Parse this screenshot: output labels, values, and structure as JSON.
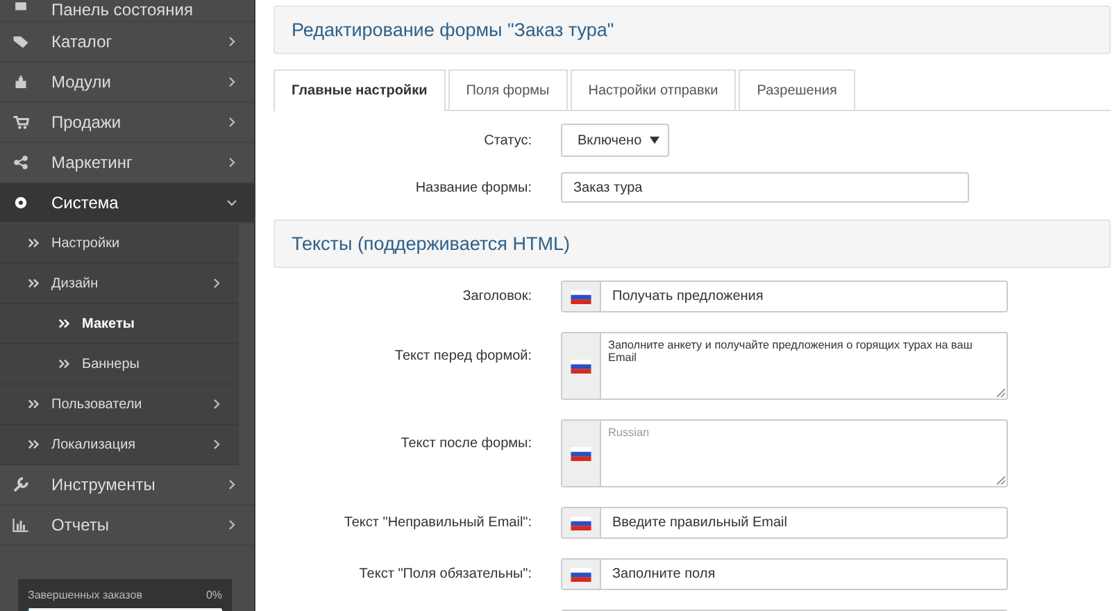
{
  "sidebar": {
    "items": [
      {
        "label": "Панель состояния",
        "selected": false
      },
      {
        "label": "Каталог",
        "selected": false,
        "expanded": false
      },
      {
        "label": "Модули",
        "selected": false,
        "expanded": false
      },
      {
        "label": "Продажи",
        "selected": false,
        "expanded": false
      },
      {
        "label": "Маркетинг",
        "selected": false,
        "expanded": false
      },
      {
        "label": "Система",
        "selected": false,
        "expanded": true,
        "children": [
          {
            "label": "Настройки",
            "selected": false
          },
          {
            "label": "Дизайн",
            "selected": false,
            "expanded": false,
            "children": [
              {
                "label": "Макеты",
                "selected": true
              },
              {
                "label": "Баннеры",
                "selected": false
              }
            ]
          },
          {
            "label": "Пользователи",
            "selected": false,
            "expanded": false
          },
          {
            "label": "Локализация",
            "selected": false,
            "expanded": false
          }
        ]
      },
      {
        "label": "Инструменты",
        "selected": false,
        "expanded": false
      },
      {
        "label": "Отчеты",
        "selected": false,
        "expanded": false
      }
    ],
    "progress": {
      "label": "Завершенных заказов",
      "reading": "0%",
      "level": 0
    }
  },
  "page": {
    "title": "Редактирование формы \"Заказ тура\"",
    "tabs": [
      {
        "label": "Главные настройки",
        "selected": true
      },
      {
        "label": "Поля формы",
        "selected": false
      },
      {
        "label": "Настройки отправки",
        "selected": false
      },
      {
        "label": "Разрешения",
        "selected": false
      }
    ],
    "general": [
      {
        "kind": "select",
        "label": "Статус:",
        "value": "Включено"
      },
      {
        "kind": "input",
        "label": "Название формы:",
        "value": "Заказ тура"
      }
    ],
    "texts_title": "Тексты (поддерживается HTML)",
    "texts": [
      {
        "kind": "line",
        "label": "Заголовок:",
        "value": "Получать предложения"
      },
      {
        "kind": "area",
        "label": "Текст перед формой:",
        "value": "Заполните анкету и получайте предложения о горящих турах на ваш Email"
      },
      {
        "kind": "area",
        "label": "Текст после формы:",
        "placeholder": "Russian"
      },
      {
        "kind": "line",
        "label": "Текст \"Неправильный Email\":",
        "value": "Введите правильный Email"
      },
      {
        "kind": "line",
        "label": "Текст \"Поля обязательны\":",
        "value": "Заполните поля"
      },
      {
        "kind": "line"
      }
    ]
  }
}
